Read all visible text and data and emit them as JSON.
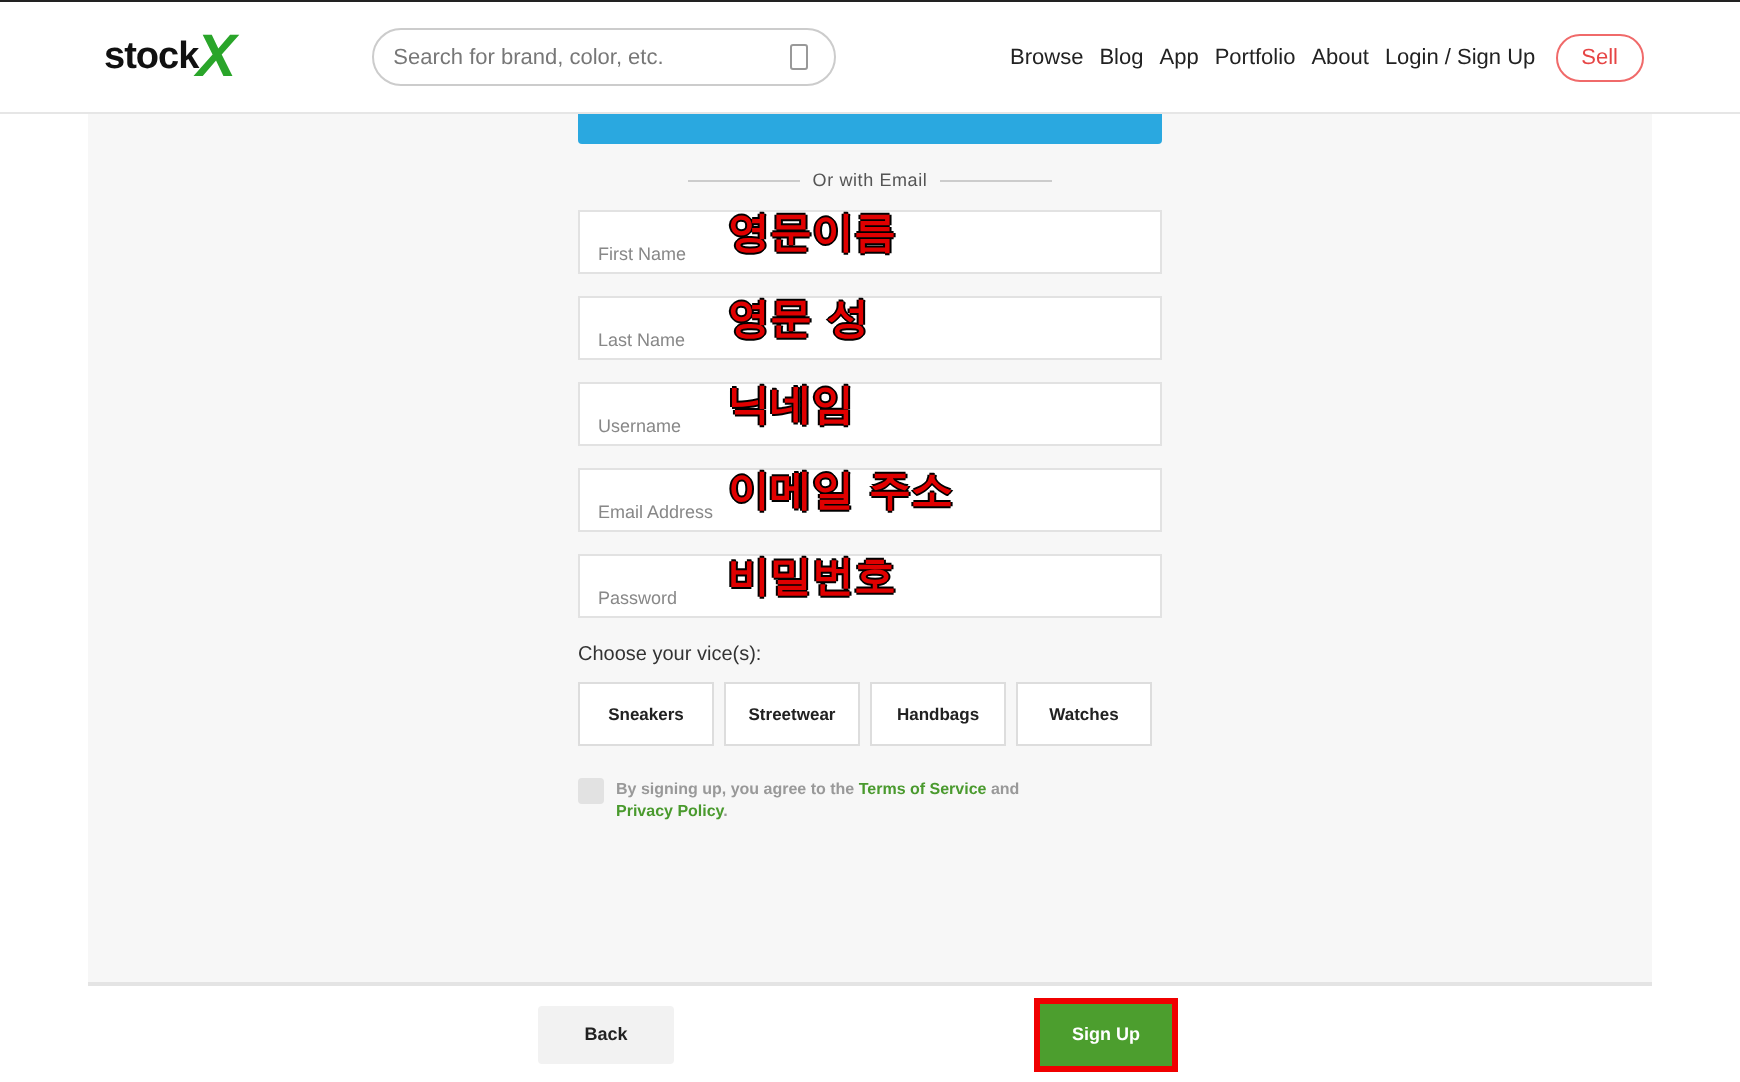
{
  "header": {
    "logo": {
      "text": "stock",
      "mark": "X"
    },
    "search": {
      "placeholder": "Search for brand, color, etc."
    },
    "nav": [
      "Browse",
      "Blog",
      "App",
      "Portfolio",
      "About",
      "Login / Sign Up"
    ],
    "sell_button": "Sell"
  },
  "divider_label": "Or with Email",
  "fields": [
    {
      "placeholder": "First Name",
      "annotation": "영문이름"
    },
    {
      "placeholder": "Last Name",
      "annotation": "영문 성"
    },
    {
      "placeholder": "Username",
      "annotation": "닉네임"
    },
    {
      "placeholder": "Email Address",
      "annotation": "이메일 주소"
    },
    {
      "placeholder": "Password",
      "annotation": "비밀번호"
    }
  ],
  "vices_label": "Choose your vice(s):",
  "vices": [
    {
      "label": "Sneakers",
      "selected": false
    },
    {
      "label": "Streetwear",
      "selected": false
    },
    {
      "label": "Handbags",
      "selected": false
    },
    {
      "label": "Watches",
      "selected": false
    }
  ],
  "agreement": {
    "checked": false,
    "text": "By signing up, you agree to the ",
    "terms_link": "Terms of Service",
    "and": " and ",
    "privacy_link": "Privacy Policy",
    "end": "."
  },
  "footer": {
    "back_button": "Back",
    "signup_button": {
      "label": "Sign Up",
      "highlighted": true
    }
  }
}
